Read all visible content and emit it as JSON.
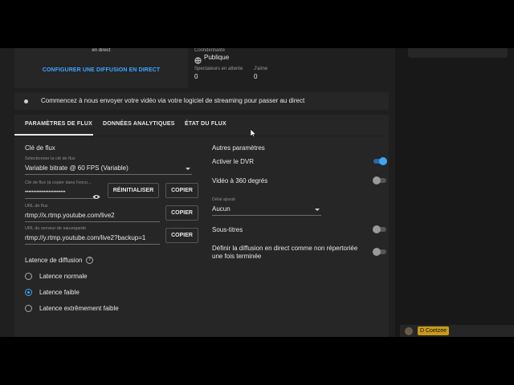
{
  "top": {
    "en_direct": "en direct",
    "configure_link": "CONFIGURER UNE DIFFUSION EN DIRECT",
    "confidentiality_label": "Confidentialité",
    "confidentiality_value": "Publique",
    "waiting_label": "Spectateurs en attente",
    "waiting_value": "0",
    "likes_label": "J'aime",
    "likes_value": "0"
  },
  "banner": {
    "text": "Commencez à nous envoyer votre vidéo via votre logiciel de streaming pour passer au direct"
  },
  "tabs": [
    {
      "label": "PARAMÈTRES DE FLUX",
      "active": true
    },
    {
      "label": "DONNÉES ANALYTIQUES",
      "active": false
    },
    {
      "label": "ÉTAT DU FLUX",
      "active": false
    }
  ],
  "stream_key": {
    "title": "Clé de flux",
    "select_label": "Sélectionner la clé de flux",
    "select_value": "Variable bitrate @ 60 FPS (Variable)",
    "key_label": "Clé de flux (à copier dans l'enco...",
    "key_value": "••••••••••••••••••••••••",
    "reset_button": "RÉINITIALISER",
    "copy_button": "COPIER",
    "url_label": "URL de flux",
    "url_value": "rtmp://x.rtmp.youtube.com/live2",
    "backup_label": "URL du serveur de sauvegarde",
    "backup_value": "rtmp://y.rtmp.youtube.com/live2?backup=1"
  },
  "latency": {
    "title": "Latence de diffusion",
    "help": "?",
    "options": [
      {
        "label": "Latence normale",
        "selected": false
      },
      {
        "label": "Latence faible",
        "selected": true
      },
      {
        "label": "Latence extrêmement faible",
        "selected": false
      }
    ]
  },
  "other": {
    "title": "Autres paramètres",
    "dvr_label": "Activer le DVR",
    "dvr_on": true,
    "video360_label": "Vidéo à 360 degrés",
    "video360_on": false,
    "delay_label": "Délai ajouté",
    "delay_value": "Aucun",
    "subtitles_label": "Sous-titres",
    "subtitles_on": false,
    "unlisted_line1": "Définir la diffusion en direct comme non répertoriée",
    "unlisted_line2": "une fois terminée",
    "unlisted_on": false
  },
  "chat": {
    "user_name": "D Coetzee"
  },
  "colors": {
    "accent": "#3ea6ff",
    "panel": "#262626",
    "background": "#1f1f1f"
  }
}
